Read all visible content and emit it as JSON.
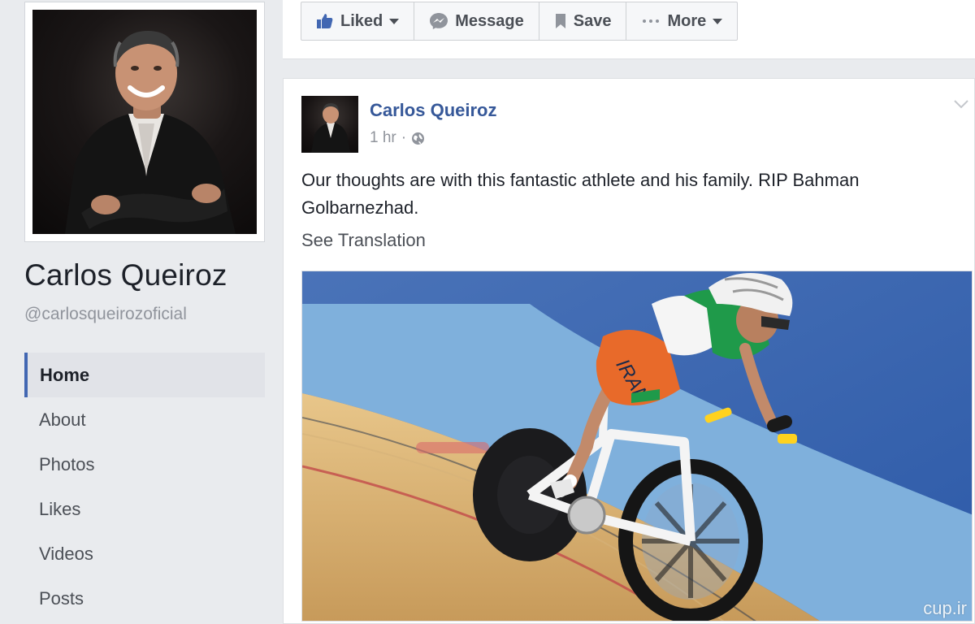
{
  "page": {
    "name": "Carlos Queiroz",
    "handle": "@carlosqueirozoficial"
  },
  "nav": {
    "items": [
      {
        "label": "Home",
        "active": true
      },
      {
        "label": "About"
      },
      {
        "label": "Photos"
      },
      {
        "label": "Likes"
      },
      {
        "label": "Videos"
      },
      {
        "label": "Posts"
      }
    ]
  },
  "actions": {
    "liked": "Liked",
    "message": "Message",
    "save": "Save",
    "more": "More"
  },
  "post": {
    "author": "Carlos Queiroz",
    "time": "1 hr",
    "privacy_icon": "globe-icon",
    "text": "Our thoughts are with this fantastic athlete and his family. RIP Bahman Golbarnezhad.",
    "see_translation": "See Translation",
    "photo_watermark": "cup.ir",
    "jersey_text": "IRAN"
  },
  "colors": {
    "background": "#e9ebee",
    "link_blue": "#365899",
    "accent": "#4267b2"
  }
}
